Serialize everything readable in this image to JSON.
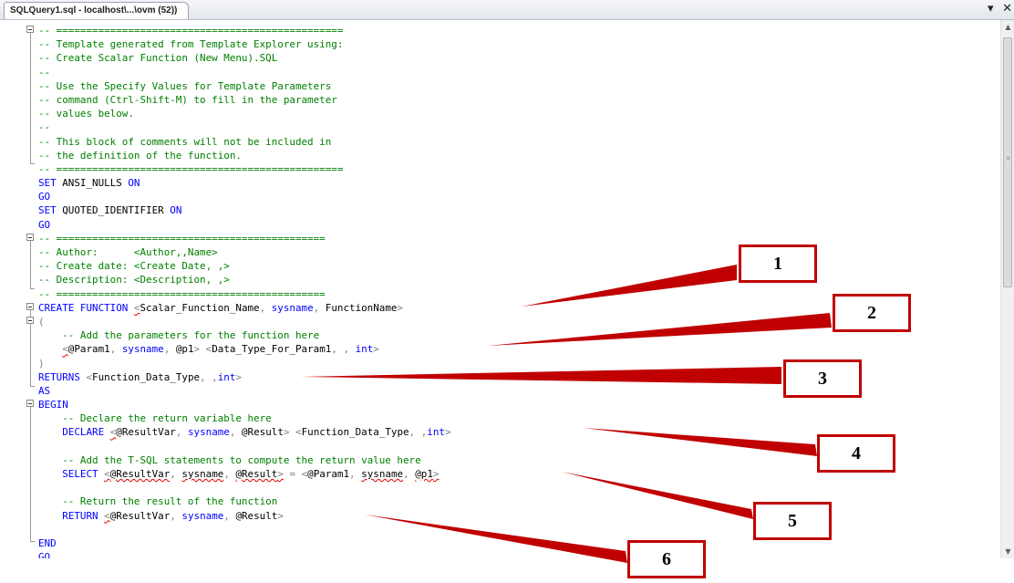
{
  "tab": {
    "title": "SQLQuery1.sql - localhost\\...\\ovm (52))"
  },
  "controls": {
    "dropdown_glyph": "▾",
    "close_glyph": "✕"
  },
  "scrollbar": {
    "up_arrow": "▲",
    "down_arrow": "▼",
    "grip": "≡"
  },
  "code": {
    "lines": [
      [
        {
          "c": "cm",
          "t": "-- ================================================"
        }
      ],
      [
        {
          "c": "cm",
          "t": "-- Template generated from Template Explorer using:"
        }
      ],
      [
        {
          "c": "cm",
          "t": "-- Create Scalar Function (New Menu).SQL"
        }
      ],
      [
        {
          "c": "cm",
          "t": "--"
        }
      ],
      [
        {
          "c": "cm",
          "t": "-- Use the Specify Values for Template Parameters"
        }
      ],
      [
        {
          "c": "cm",
          "t": "-- command (Ctrl-Shift-M) to fill in the parameter"
        }
      ],
      [
        {
          "c": "cm",
          "t": "-- values below."
        }
      ],
      [
        {
          "c": "cm",
          "t": "--"
        }
      ],
      [
        {
          "c": "cm",
          "t": "-- This block of comments will not be included in"
        }
      ],
      [
        {
          "c": "cm",
          "t": "-- the definition of the function."
        }
      ],
      [
        {
          "c": "cm",
          "t": "-- ================================================"
        }
      ],
      [
        {
          "c": "kw",
          "t": "SET "
        },
        {
          "c": "",
          "t": "ANSI_NULLS "
        },
        {
          "c": "kw",
          "t": "ON"
        }
      ],
      [
        {
          "c": "kw",
          "t": "GO"
        }
      ],
      [
        {
          "c": "kw",
          "t": "SET "
        },
        {
          "c": "",
          "t": "QUOTED_IDENTIFIER "
        },
        {
          "c": "kw",
          "t": "ON"
        }
      ],
      [
        {
          "c": "kw",
          "t": "GO"
        }
      ],
      [
        {
          "c": "cm",
          "t": "-- ============================================="
        }
      ],
      [
        {
          "c": "cm",
          "t": "-- Author:      <Author,,Name>"
        }
      ],
      [
        {
          "c": "cm",
          "t": "-- Create date: <Create Date, ,>"
        }
      ],
      [
        {
          "c": "cm",
          "t": "-- Description: <Description, ,>"
        }
      ],
      [
        {
          "c": "cm",
          "t": "-- ============================================="
        }
      ],
      [
        {
          "c": "kw",
          "t": "CREATE FUNCTION "
        },
        {
          "c": "gy sq",
          "t": "<"
        },
        {
          "c": "",
          "t": "Scalar_Function_Name"
        },
        {
          "c": "gy",
          "t": ", "
        },
        {
          "c": "kw",
          "t": "sysname"
        },
        {
          "c": "gy",
          "t": ", "
        },
        {
          "c": "",
          "t": "FunctionName"
        },
        {
          "c": "gy",
          "t": ">"
        }
      ],
      [
        {
          "c": "gy",
          "t": "("
        }
      ],
      [
        {
          "c": "cm",
          "t": "    -- Add the parameters for the function here"
        }
      ],
      [
        {
          "c": "",
          "t": "    "
        },
        {
          "c": "gy sq",
          "t": "<"
        },
        {
          "c": "",
          "t": "@Param1"
        },
        {
          "c": "gy",
          "t": ", "
        },
        {
          "c": "kw",
          "t": "sysname"
        },
        {
          "c": "gy",
          "t": ", "
        },
        {
          "c": "",
          "t": "@p1"
        },
        {
          "c": "gy",
          "t": "> <"
        },
        {
          "c": "",
          "t": "Data_Type_For_Param1"
        },
        {
          "c": "gy",
          "t": ", , "
        },
        {
          "c": "kw",
          "t": "int"
        },
        {
          "c": "gy",
          "t": ">"
        }
      ],
      [
        {
          "c": "gy",
          "t": ")"
        }
      ],
      [
        {
          "c": "kw",
          "t": "RETURNS "
        },
        {
          "c": "gy",
          "t": "<"
        },
        {
          "c": "",
          "t": "Function_Data_Type"
        },
        {
          "c": "gy",
          "t": ", ,"
        },
        {
          "c": "kw",
          "t": "int"
        },
        {
          "c": "gy",
          "t": ">"
        }
      ],
      [
        {
          "c": "kw",
          "t": "AS"
        }
      ],
      [
        {
          "c": "kw",
          "t": "BEGIN"
        }
      ],
      [
        {
          "c": "cm",
          "t": "    -- Declare the return variable here"
        }
      ],
      [
        {
          "c": "",
          "t": "    "
        },
        {
          "c": "kw",
          "t": "DECLARE "
        },
        {
          "c": "gy sq",
          "t": "<"
        },
        {
          "c": "",
          "t": "@ResultVar"
        },
        {
          "c": "gy",
          "t": ", "
        },
        {
          "c": "kw",
          "t": "sysname"
        },
        {
          "c": "gy",
          "t": ", "
        },
        {
          "c": "",
          "t": "@Result"
        },
        {
          "c": "gy",
          "t": "> <"
        },
        {
          "c": "",
          "t": "Function_Data_Type"
        },
        {
          "c": "gy",
          "t": ", ,"
        },
        {
          "c": "kw",
          "t": "int"
        },
        {
          "c": "gy",
          "t": ">"
        }
      ],
      [
        {
          "c": "",
          "t": ""
        }
      ],
      [
        {
          "c": "cm",
          "t": "    -- Add the T-SQL statements to compute the return value here"
        }
      ],
      [
        {
          "c": "",
          "t": "    "
        },
        {
          "c": "kw",
          "t": "SELECT "
        },
        {
          "c": "gy sq",
          "t": "<"
        },
        {
          "c": "sq",
          "t": "@ResultVar"
        },
        {
          "c": "gy",
          "t": ", "
        },
        {
          "c": "sq",
          "t": "sysname"
        },
        {
          "c": "gy",
          "t": ", "
        },
        {
          "c": "sq",
          "t": "@Result"
        },
        {
          "c": "gy sq",
          "t": ">"
        },
        {
          "c": "gy",
          "t": " = <"
        },
        {
          "c": "",
          "t": "@Param1"
        },
        {
          "c": "gy",
          "t": ", "
        },
        {
          "c": "sq",
          "t": "sysname"
        },
        {
          "c": "gy",
          "t": ", "
        },
        {
          "c": "sq",
          "t": "@p1"
        },
        {
          "c": "gy sq",
          "t": ">"
        }
      ],
      [
        {
          "c": "",
          "t": ""
        }
      ],
      [
        {
          "c": "cm",
          "t": "    -- Return the result of the function"
        }
      ],
      [
        {
          "c": "",
          "t": "    "
        },
        {
          "c": "kw",
          "t": "RETURN "
        },
        {
          "c": "gy sq",
          "t": "<"
        },
        {
          "c": "",
          "t": "@ResultVar"
        },
        {
          "c": "gy",
          "t": ", "
        },
        {
          "c": "kw",
          "t": "sysname"
        },
        {
          "c": "gy",
          "t": ", "
        },
        {
          "c": "",
          "t": "@Result"
        },
        {
          "c": "gy",
          "t": ">"
        }
      ],
      [
        {
          "c": "",
          "t": ""
        }
      ],
      [
        {
          "c": "kw",
          "t": "END"
        }
      ],
      [
        {
          "c": "kw",
          "t": "GO"
        }
      ]
    ]
  },
  "annotations": {
    "color": "#c00000",
    "callouts": [
      {
        "number": "1"
      },
      {
        "number": "2"
      },
      {
        "number": "3"
      },
      {
        "number": "4"
      },
      {
        "number": "5"
      },
      {
        "number": "6"
      }
    ]
  }
}
